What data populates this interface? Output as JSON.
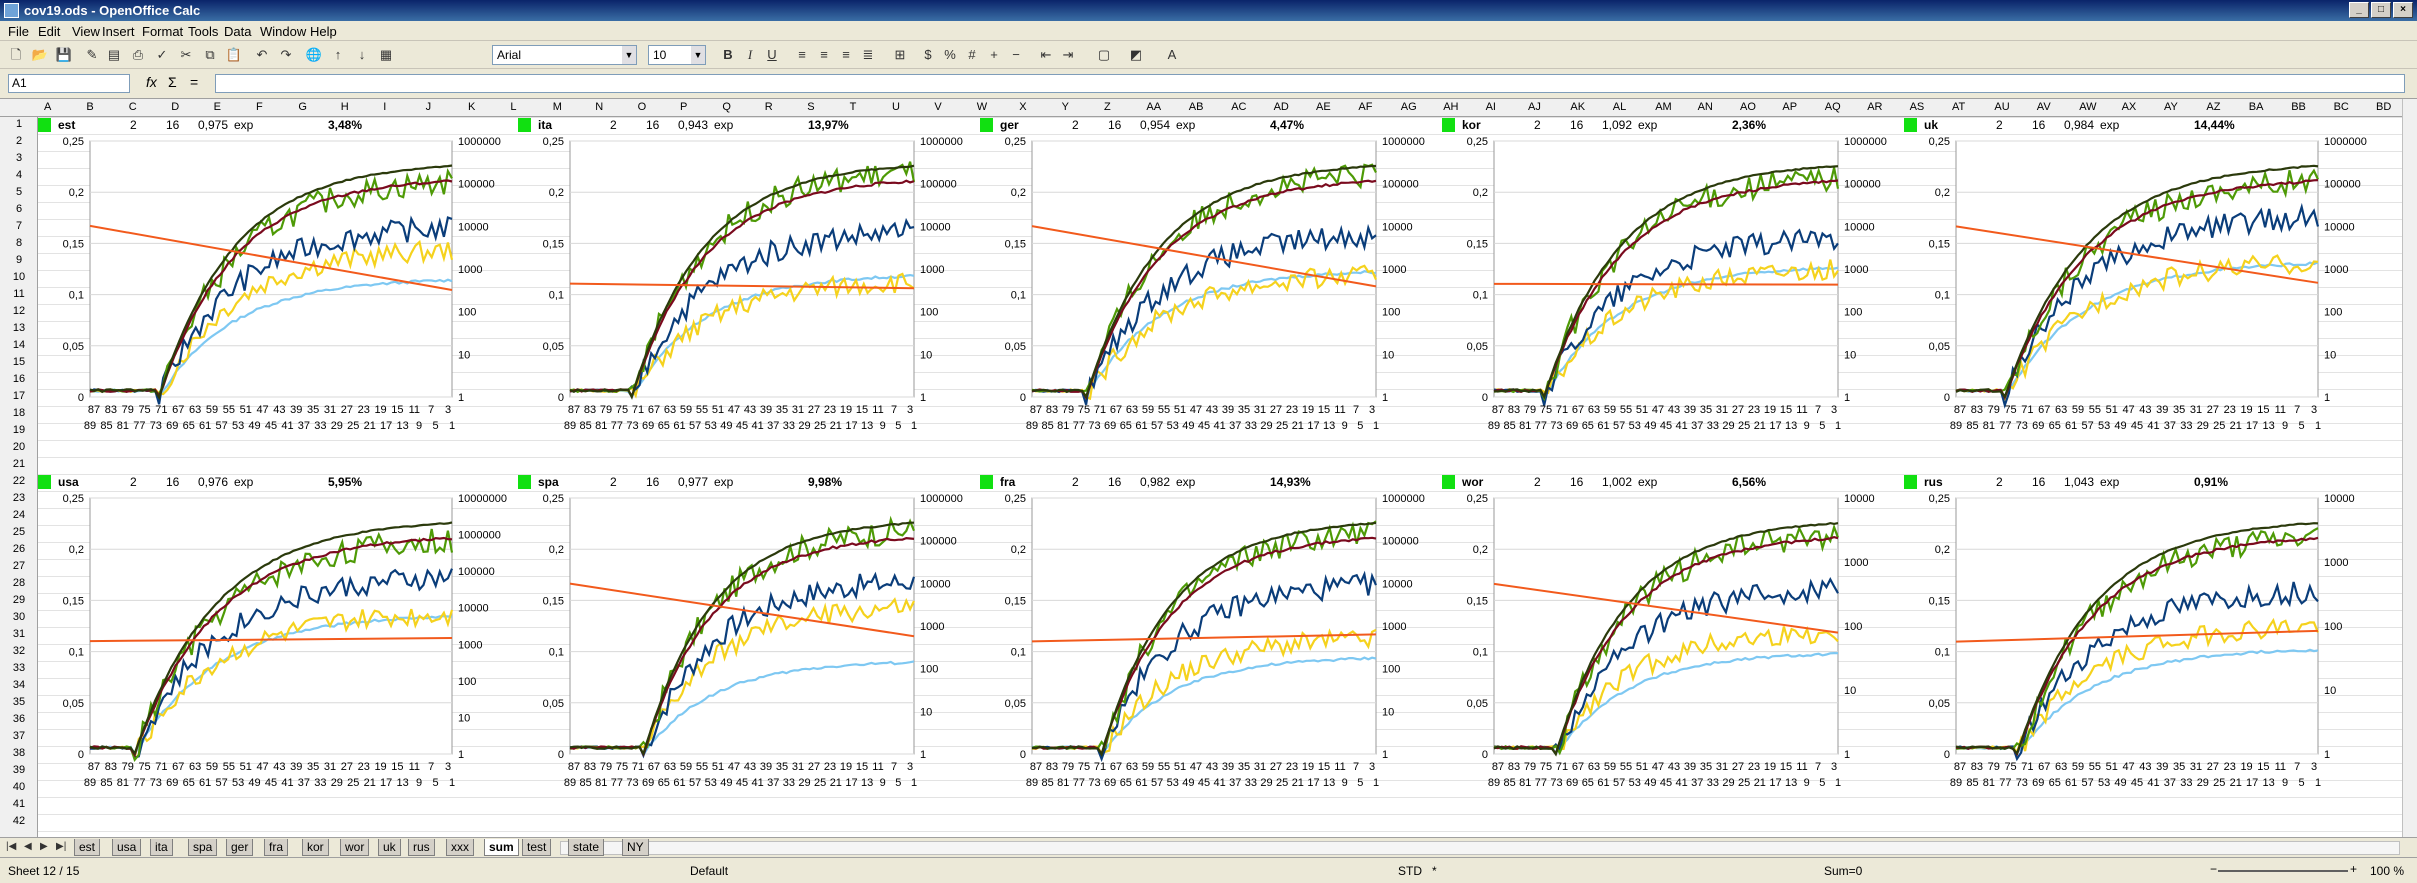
{
  "window": {
    "title": "cov19.ods - OpenOffice Calc"
  },
  "menu": [
    "File",
    "Edit",
    "View",
    "Insert",
    "Format",
    "Tools",
    "Data",
    "Window",
    "Help"
  ],
  "toolbar": {
    "font_name": "Arial",
    "font_size": "10"
  },
  "formula": {
    "cell_ref": "A1",
    "content": ""
  },
  "columns": [
    "A",
    "B",
    "C",
    "D",
    "E",
    "F",
    "G",
    "H",
    "I",
    "J",
    "K",
    "L",
    "M",
    "N",
    "O",
    "P",
    "Q",
    "R",
    "S",
    "T",
    "U",
    "V",
    "W",
    "X",
    "Y",
    "Z",
    "AA",
    "AB",
    "AC",
    "AD",
    "AE",
    "AF",
    "AG",
    "AH",
    "AI",
    "AJ",
    "AK",
    "AL",
    "AM",
    "AN",
    "AO",
    "AP",
    "AQ",
    "AR",
    "AS",
    "AT",
    "AU",
    "AV",
    "AW",
    "AX",
    "AY",
    "AZ",
    "BA",
    "BB",
    "BC",
    "BD"
  ],
  "rows": [
    "1",
    "2",
    "3",
    "4",
    "5",
    "6",
    "7",
    "8",
    "9",
    "10",
    "11",
    "12",
    "13",
    "14",
    "15",
    "16",
    "17",
    "18",
    "19",
    "20",
    "21",
    "22",
    "23",
    "24",
    "25",
    "26",
    "27",
    "28",
    "29",
    "30",
    "31",
    "32",
    "33",
    "34",
    "35",
    "36",
    "37",
    "38",
    "39",
    "40",
    "41",
    "42"
  ],
  "panels": [
    {
      "country": "est",
      "n1": "2",
      "n2": "16",
      "factor": "0,975",
      "model": "exp",
      "rate": "3,48%"
    },
    {
      "country": "ita",
      "n1": "2",
      "n2": "16",
      "factor": "0,943",
      "model": "exp",
      "rate": "13,97%"
    },
    {
      "country": "ger",
      "n1": "2",
      "n2": "16",
      "factor": "0,954",
      "model": "exp",
      "rate": "4,47%"
    },
    {
      "country": "kor",
      "n1": "2",
      "n2": "16",
      "factor": "1,092",
      "model": "exp",
      "rate": "2,36%"
    },
    {
      "country": "uk",
      "n1": "2",
      "n2": "16",
      "factor": "0,984",
      "model": "exp",
      "rate": "14,44%"
    },
    {
      "country": "usa",
      "n1": "2",
      "n2": "16",
      "factor": "0,976",
      "model": "exp",
      "rate": "5,95%"
    },
    {
      "country": "spa",
      "n1": "2",
      "n2": "16",
      "factor": "0,977",
      "model": "exp",
      "rate": "9,98%"
    },
    {
      "country": "fra",
      "n1": "2",
      "n2": "16",
      "factor": "0,982",
      "model": "exp",
      "rate": "14,93%"
    },
    {
      "country": "wor",
      "n1": "2",
      "n2": "16",
      "factor": "1,002",
      "model": "exp",
      "rate": "6,56%"
    },
    {
      "country": "rus",
      "n1": "2",
      "n2": "16",
      "factor": "1,043",
      "model": "exp",
      "rate": "0,91%"
    }
  ],
  "chart_axes": {
    "left_ticks": [
      "0",
      "0,05",
      "0,1",
      "0,15",
      "0,2",
      "0,25"
    ],
    "right_ticks_top": [
      "1",
      "10",
      "100",
      "1000",
      "10000",
      "100000",
      "1000000"
    ],
    "right_ticks_small": [
      "1",
      "10",
      "100",
      "1000",
      "10000"
    ],
    "right_ticks_usa": [
      "1",
      "10",
      "100",
      "1000",
      "10000",
      "100000",
      "1000000",
      "10000000"
    ],
    "x_ticks_row1": [
      "87",
      "83",
      "79",
      "75",
      "71",
      "67",
      "63",
      "59",
      "55",
      "51",
      "47",
      "43",
      "39",
      "35",
      "31",
      "27",
      "23",
      "19",
      "15",
      "11",
      "7",
      "3"
    ],
    "x_ticks_row2": [
      "89",
      "85",
      "81",
      "77",
      "73",
      "69",
      "65",
      "61",
      "57",
      "53",
      "49",
      "45",
      "41",
      "37",
      "33",
      "29",
      "25",
      "21",
      "17",
      "13",
      "9",
      "5",
      "1"
    ]
  },
  "colors": {
    "green": "#4e9a06",
    "darkred": "#7a0a1e",
    "darkolive": "#2b3a0c",
    "navy": "#0a3d7a",
    "yellow": "#f5d21d",
    "lightblue": "#7ec8f2",
    "orange": "#f25a1c"
  },
  "sheet_tabs": [
    "est",
    "usa",
    "ita",
    "spa",
    "ger",
    "fra",
    "kor",
    "wor",
    "uk",
    "rus",
    "xxx",
    "sum",
    "test",
    "state",
    "NY"
  ],
  "active_tab": "sum",
  "status": {
    "sheet": "Sheet 12 / 15",
    "style": "Default",
    "mode": "STD",
    "modified": "*",
    "sum": "Sum=0",
    "zoom": "100 %"
  }
}
